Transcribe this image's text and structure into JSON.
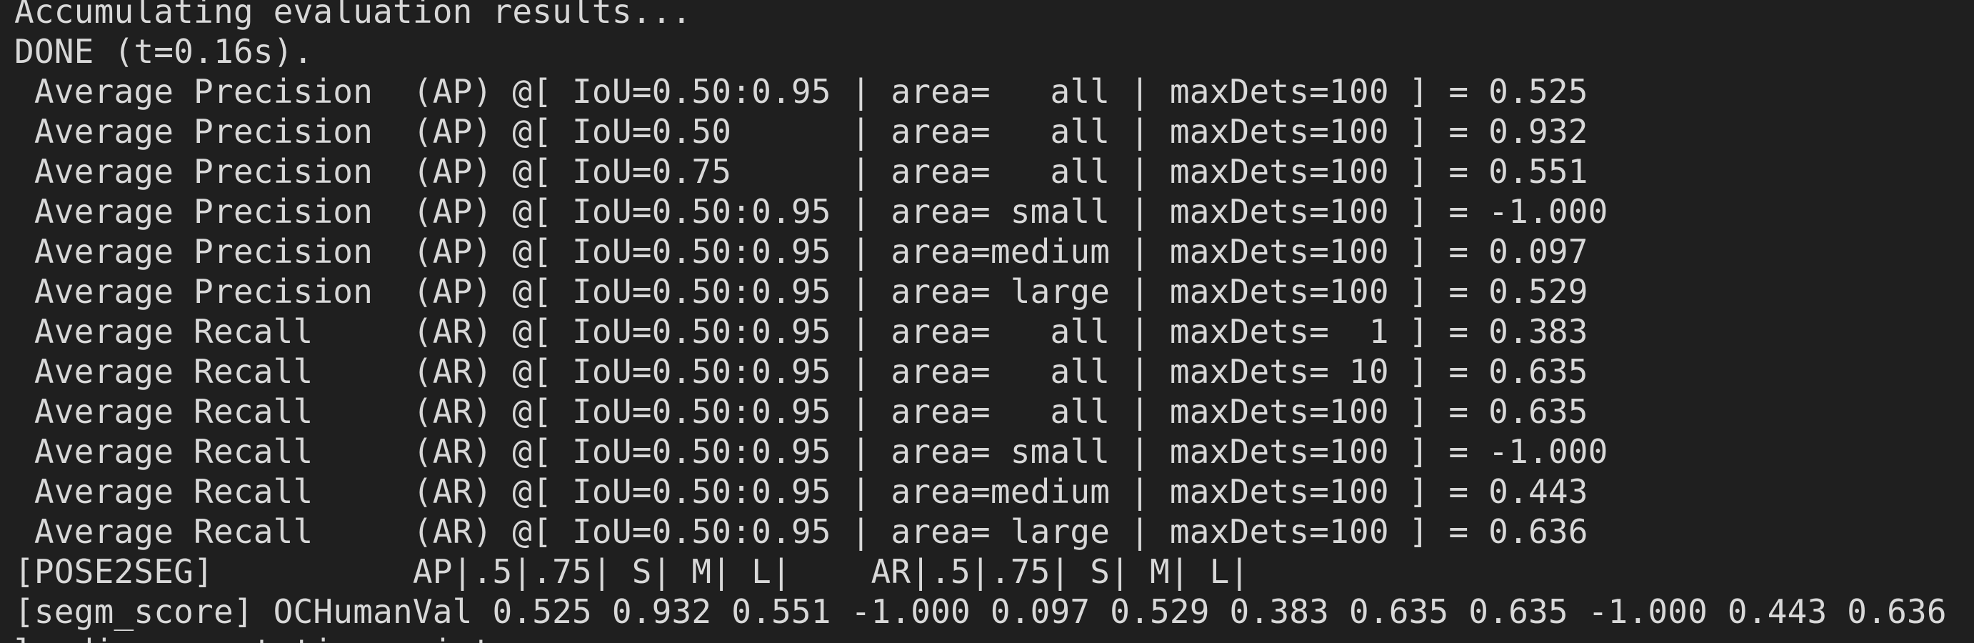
{
  "terminal": {
    "background": "#1f1f1f",
    "foreground": "#d8d8d8",
    "lines": {
      "accumulating": "Accumulating evaluation results...",
      "done": "DONE (t=0.16s).",
      "metric_0": " Average Precision  (AP) @[ IoU=0.50:0.95 | area=   all | maxDets=100 ] = 0.525",
      "metric_1": " Average Precision  (AP) @[ IoU=0.50      | area=   all | maxDets=100 ] = 0.932",
      "metric_2": " Average Precision  (AP) @[ IoU=0.75      | area=   all | maxDets=100 ] = 0.551",
      "metric_3": " Average Precision  (AP) @[ IoU=0.50:0.95 | area= small | maxDets=100 ] = -1.000",
      "metric_4": " Average Precision  (AP) @[ IoU=0.50:0.95 | area=medium | maxDets=100 ] = 0.097",
      "metric_5": " Average Precision  (AP) @[ IoU=0.50:0.95 | area= large | maxDets=100 ] = 0.529",
      "metric_6": " Average Recall     (AR) @[ IoU=0.50:0.95 | area=   all | maxDets=  1 ] = 0.383",
      "metric_7": " Average Recall     (AR) @[ IoU=0.50:0.95 | area=   all | maxDets= 10 ] = 0.635",
      "metric_8": " Average Recall     (AR) @[ IoU=0.50:0.95 | area=   all | maxDets=100 ] = 0.635",
      "metric_9": " Average Recall     (AR) @[ IoU=0.50:0.95 | area= small | maxDets=100 ] = -1.000",
      "metric_10": " Average Recall     (AR) @[ IoU=0.50:0.95 | area=medium | maxDets=100 ] = 0.443",
      "metric_11": " Average Recall     (AR) @[ IoU=0.50:0.95 | area= large | maxDets=100 ] = 0.636",
      "pose2seg_header": "[POSE2SEG]          AP|.5|.75| S| M| L|    AR|.5|.75| S| M| L|",
      "segm_score": "[segm_score] OCHumanVal 0.525 0.932 0.551 -1.000 0.097 0.529 0.383 0.635 0.635 -1.000 0.443 0.636",
      "partial_next": "l  di  ...  t ti     i t"
    }
  }
}
